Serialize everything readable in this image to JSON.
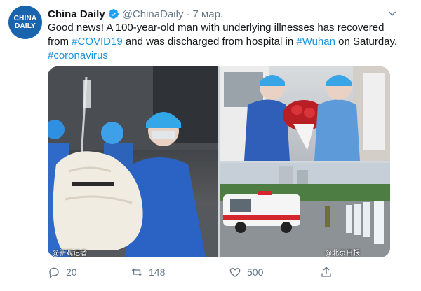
{
  "account": {
    "name": "China Daily",
    "handle": "@ChinaDaily",
    "separator": "·",
    "date": "7 мар.",
    "avatar_text": [
      "CHINA",
      "DAILY"
    ]
  },
  "tweet": {
    "text_parts": [
      {
        "text": "Good news! A 100-year-old man with underlying illnesses has recovered from ",
        "link": false
      },
      {
        "text": "#COVID19",
        "link": true
      },
      {
        "text": " and was discharged from hospital in ",
        "link": false
      },
      {
        "text": "#Wuhan",
        "link": true
      },
      {
        "text": " on Saturday. ",
        "link": false
      },
      {
        "text": "#coronavirus",
        "link": true
      }
    ]
  },
  "media": {
    "watermarks": [
      "@新观记者",
      "@北京日报"
    ]
  },
  "actions": {
    "reply_count": "20",
    "retweet_count": "148",
    "like_count": "500"
  },
  "colors": {
    "link": "#1b95e0",
    "secondary": "#657786",
    "brand": "#1a63ad"
  }
}
